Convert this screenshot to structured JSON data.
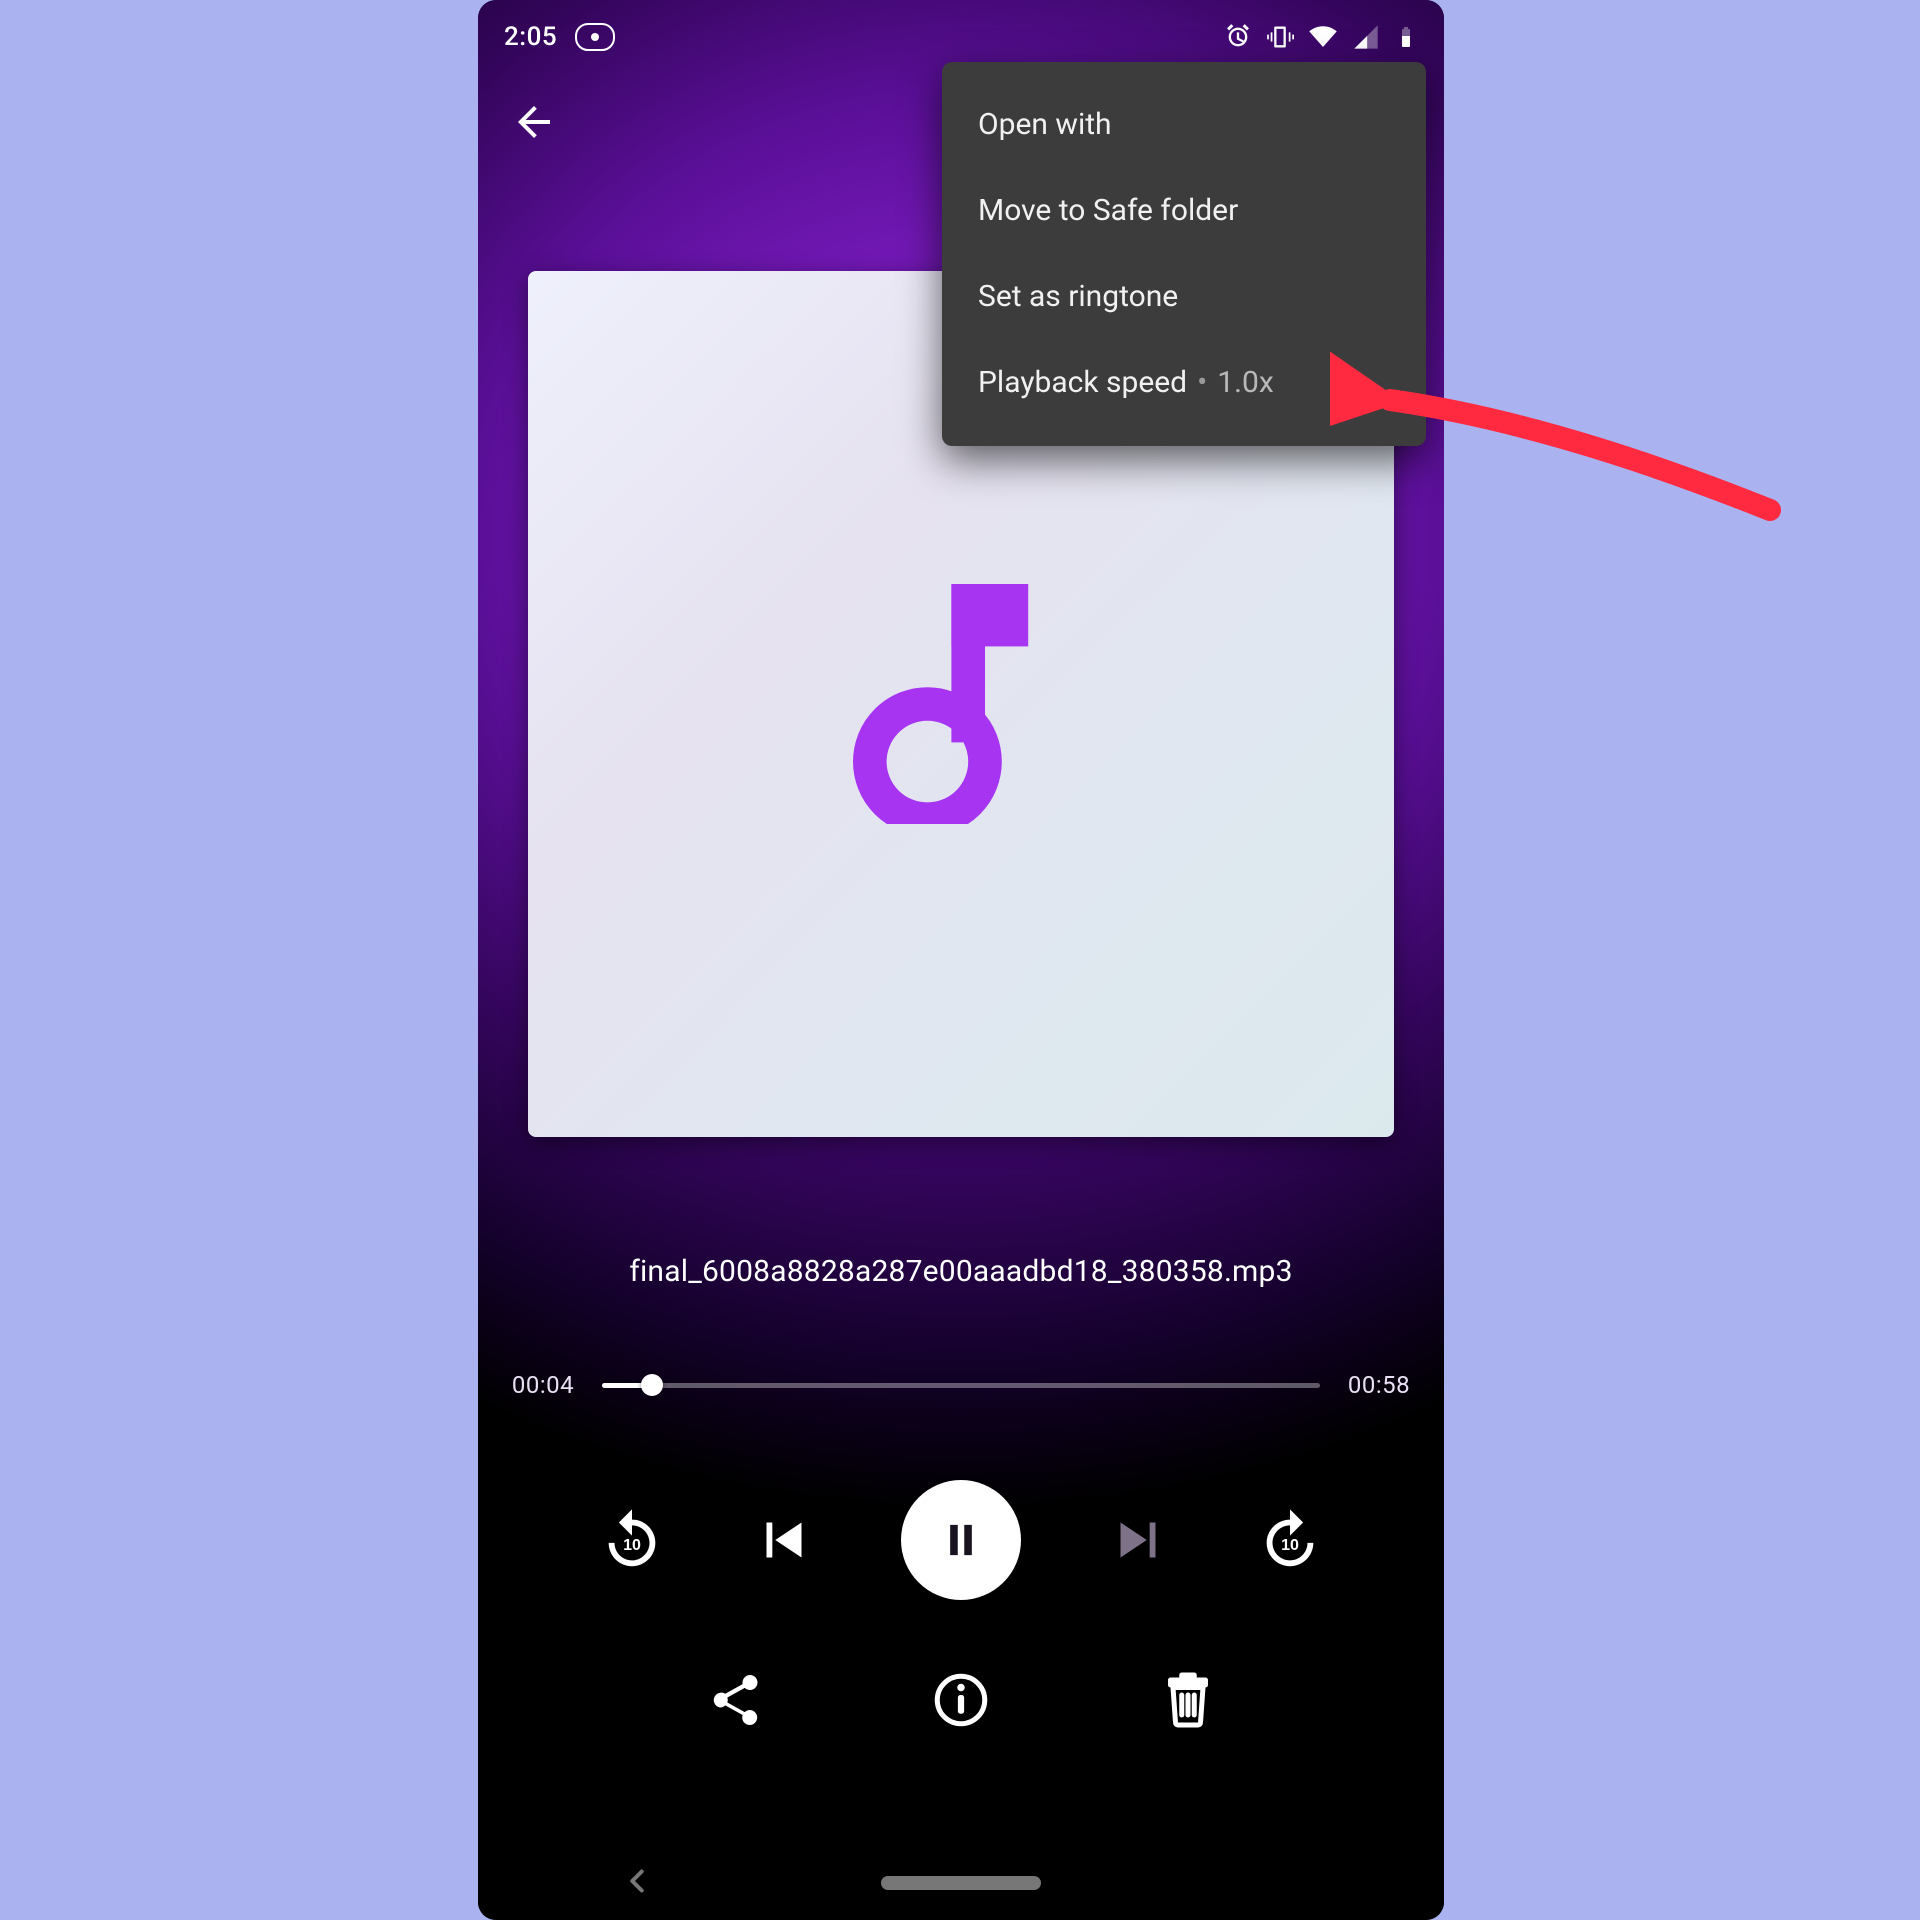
{
  "status_bar": {
    "clock": "2:05",
    "icons": {
      "recording": "recording-indicator-icon",
      "alarm": "alarm-icon",
      "vibrate": "vibrate-icon",
      "wifi": "wifi-icon",
      "signal": "cell-signal-icon",
      "battery": "battery-icon"
    }
  },
  "menu": {
    "items": [
      {
        "label": "Open with"
      },
      {
        "label": "Move to Safe folder"
      },
      {
        "label": "Set as ringtone"
      },
      {
        "label": "Playback speed",
        "value": "1.0x"
      }
    ]
  },
  "player": {
    "file_name": "final_6008a8828a287e00aaadbd18_380358.mp3",
    "elapsed": "00:04",
    "duration": "00:58",
    "progress_percent": 6.9,
    "colors": {
      "accent": "#9a32ec",
      "note": "#a634f1"
    }
  },
  "controls": {
    "rewind_seconds": "10",
    "forward_seconds": "10"
  },
  "annotation": {
    "target": "Set as ringtone",
    "arrow_color": "#ff2a40"
  }
}
